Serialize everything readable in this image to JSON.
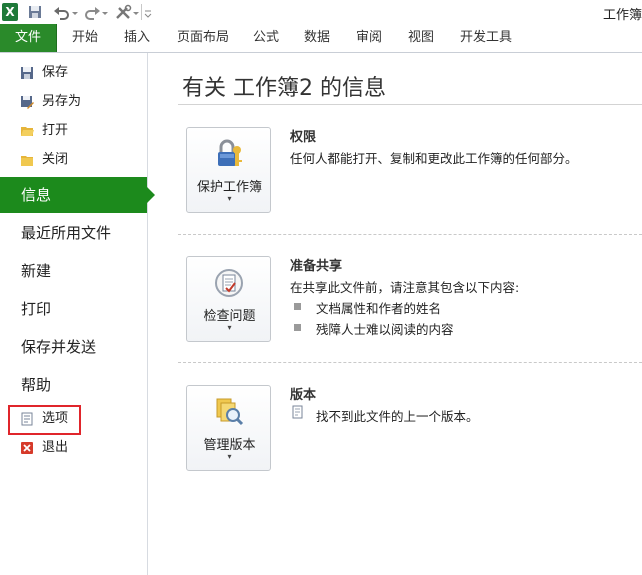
{
  "app": {
    "logo_letter": "X",
    "title": "工作簿"
  },
  "ribbon_tabs": [
    "文件",
    "开始",
    "插入",
    "页面布局",
    "公式",
    "数据",
    "审阅",
    "视图",
    "开发工具"
  ],
  "sidebar": {
    "small_items": [
      {
        "label": "保存",
        "icon": "save-icon"
      },
      {
        "label": "另存为",
        "icon": "save-as-icon"
      },
      {
        "label": "打开",
        "icon": "open-folder-icon"
      },
      {
        "label": "关闭",
        "icon": "close-folder-icon"
      }
    ],
    "big_items": [
      "信息",
      "最近所用文件",
      "新建",
      "打印",
      "保存并发送",
      "帮助"
    ],
    "active": "信息",
    "bottom_items": [
      {
        "label": "选项",
        "icon": "options-icon"
      },
      {
        "label": "退出",
        "icon": "exit-icon"
      }
    ]
  },
  "main": {
    "heading": "有关 工作簿2 的信息",
    "sections": [
      {
        "button": "保护工作簿",
        "arrow": "▾",
        "icon": "lock-key-icon",
        "title": "权限",
        "text": "任何人都能打开、复制和更改此工作簿的任何部分。",
        "bullets": []
      },
      {
        "button": "检查问题",
        "arrow": "▾",
        "icon": "inspect-document-icon",
        "title": "准备共享",
        "text": "在共享此文件前，请注意其包含以下内容:",
        "bullets": [
          "文档属性和作者的姓名",
          "残障人士难以阅读的内容"
        ]
      },
      {
        "button": "管理版本",
        "arrow": "▾",
        "icon": "manage-versions-icon",
        "title": "版本",
        "text": "找不到此文件的上一个版本。",
        "bullets": []
      }
    ]
  },
  "colors": {
    "accent": "#1c8a1c",
    "highlight_box": "#e0252b"
  }
}
